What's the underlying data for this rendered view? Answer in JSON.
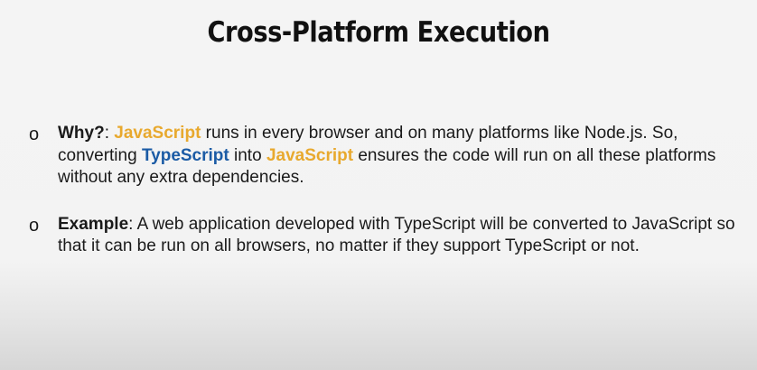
{
  "slide": {
    "title": "Cross-Platform Execution"
  },
  "bullets": [
    {
      "marker": "o",
      "label": "Why?",
      "parts": [
        ": ",
        "JavaScript",
        " runs in every browser and on many platforms like Node.js. So, converting ",
        "TypeScript",
        " into ",
        "JavaScript",
        " ensures the code will run on all these platforms without any extra dependencies."
      ]
    },
    {
      "marker": "o",
      "label": "Example",
      "text": ": A web application developed with TypeScript will be converted to JavaScript so that it can be run on all browsers, no matter if they support TypeScript or not."
    }
  ],
  "colors": {
    "javascript_highlight": "#e8a92e",
    "typescript_highlight": "#1b5ba5",
    "background": "#f4f4f4"
  }
}
